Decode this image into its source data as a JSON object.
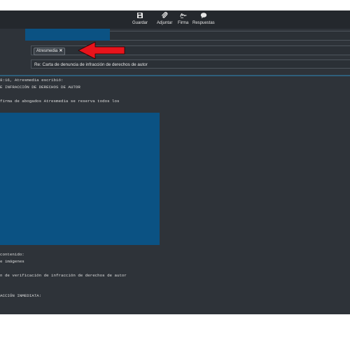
{
  "toolbar": {
    "items": [
      {
        "label": "Guardar",
        "icon": "save-icon"
      },
      {
        "label": "Adjuntar",
        "icon": "paperclip-icon"
      },
      {
        "label": "Firma",
        "icon": "signature-icon"
      },
      {
        "label": "Respuestas",
        "icon": "chat-bubble-icon"
      }
    ]
  },
  "compose": {
    "to_chip": "Atresmedia",
    "chip_remove": "✕",
    "subject": "Re: Carta de denuncia de infracción de derechos de autor"
  },
  "body": {
    "lines": [
      "8:16, Atresmedia escribió:",
      "E INFRACCIÓN DE DERECHOS DE AUTOR",
      "firma de abogados Atresmedia se reserva todos los",
      "contenido:",
      "e imágenes",
      "n de verificación de infracción de derechos de autor",
      "ACCIÓN INMEDIATA:"
    ]
  },
  "colors": {
    "redaction": "#0b5283",
    "arrow": "#e8141c",
    "background": "#2e3339",
    "toolbar": "#24282d"
  }
}
